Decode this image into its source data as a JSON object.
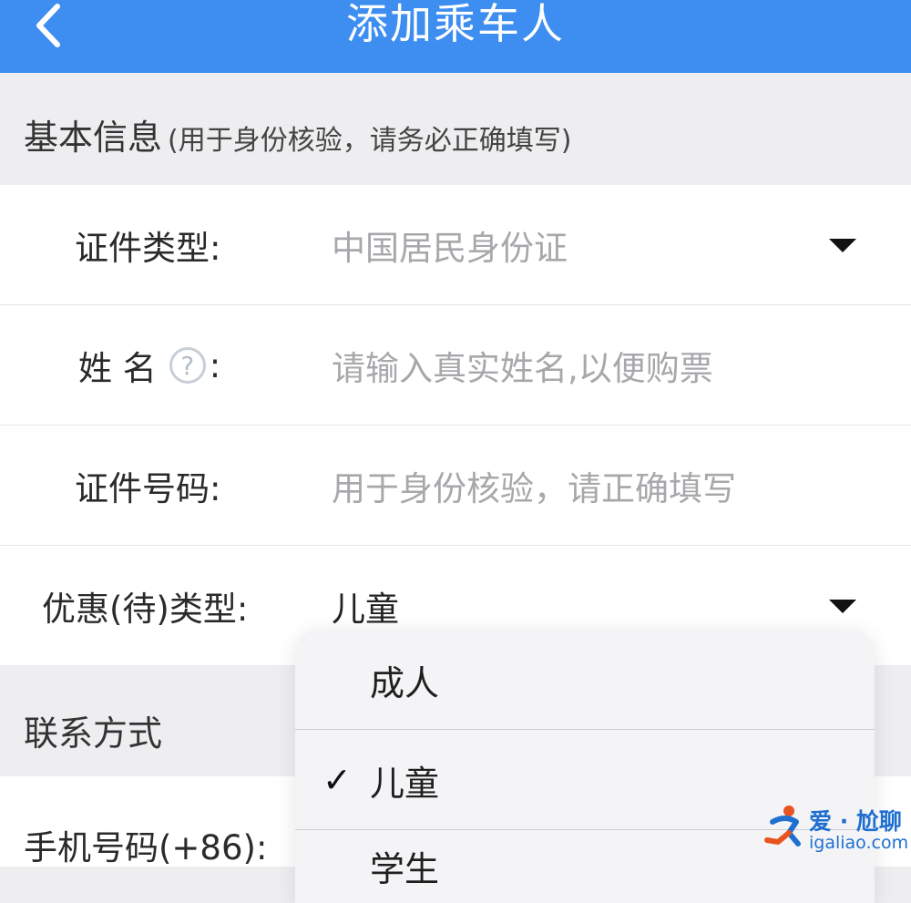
{
  "header": {
    "title": "添加乘车人",
    "background_color": "#3d8ef0"
  },
  "basic_info": {
    "title": "基本信息",
    "note": "(用于身份核验，请务必正确填写)"
  },
  "form": {
    "id_type": {
      "label": "证件类型:",
      "value": "中国居民身份证"
    },
    "name": {
      "label": "姓 名",
      "help_icon": "?",
      "colon": ":",
      "placeholder": "请输入真实姓名,以便购票"
    },
    "id_number": {
      "label": "证件号码:",
      "placeholder": "用于身份核验，请正确填写"
    },
    "discount_type": {
      "label": "优惠(待)类型:",
      "value": "儿童"
    }
  },
  "contact": {
    "title": "联系方式",
    "phone_label": "手机号码(+86):"
  },
  "dropdown": {
    "options": [
      {
        "label": "成人",
        "selected": false
      },
      {
        "label": "儿童",
        "selected": true
      }
    ],
    "check_mark": "✓",
    "partial_next": "学生"
  },
  "watermark": {
    "text": "爱 · 尬聊",
    "domain": "igaliao.com"
  }
}
